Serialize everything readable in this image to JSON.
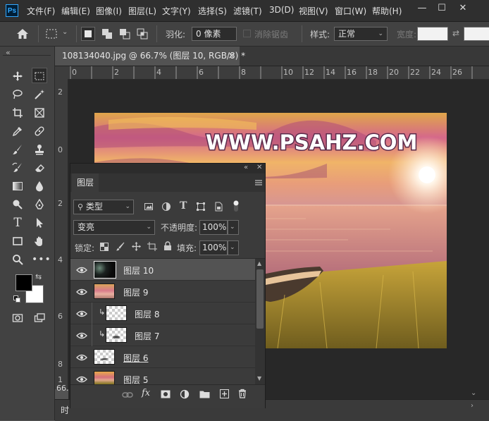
{
  "app": {
    "logo": "Ps"
  },
  "menu": [
    "文件(F)",
    "编辑(E)",
    "图像(I)",
    "图层(L)",
    "文字(Y)",
    "选择(S)",
    "滤镜(T)",
    "3D(D)",
    "视图(V)",
    "窗口(W)",
    "帮助(H)"
  ],
  "window_controls": {
    "minimize": "—",
    "maximize": "☐",
    "close": "✕"
  },
  "options_bar": {
    "feather_label": "羽化:",
    "feather_value": "0 像素",
    "antialias_label": "消除锯齿",
    "style_label": "样式:",
    "style_value": "正常",
    "width_label": "宽度:"
  },
  "document": {
    "tab_title": "108134040.jpg @ 66.7% (图层 10, RGB/8) *",
    "tab_close": "×",
    "zoom_status": "66.",
    "status_text": "时",
    "ruler_top": [
      "0",
      "2",
      "4",
      "6",
      "8",
      "10",
      "12",
      "14",
      "16",
      "18",
      "20",
      "22",
      "24",
      "26"
    ],
    "ruler_left": [
      "2",
      "0",
      "2",
      "4",
      "6",
      "8",
      "1"
    ],
    "image_watermark": "WWW.PSAHZ.COM"
  },
  "toolbar_collapse": "«",
  "layers_panel": {
    "collapse": "«",
    "close": "✕",
    "tab_label": "图层",
    "filter_label": "类型",
    "blend_mode": "变亮",
    "opacity_label": "不透明度:",
    "opacity_value": "100%",
    "lock_label": "锁定:",
    "fill_label": "填充:",
    "fill_value": "100%",
    "layers": [
      {
        "name": "图层 10",
        "selected": true,
        "clipped": false,
        "thumb": "dark-flare"
      },
      {
        "name": "图层 9",
        "selected": false,
        "clipped": false,
        "thumb": "sky"
      },
      {
        "name": "图层 8",
        "selected": false,
        "clipped": true,
        "thumb": "transparent"
      },
      {
        "name": "图层 7",
        "selected": false,
        "clipped": true,
        "thumb": "transparent"
      },
      {
        "name": "图层 6",
        "selected": false,
        "clipped": false,
        "thumb": "transparent"
      },
      {
        "name": "图层 5",
        "selected": false,
        "clipped": false,
        "thumb": "sunset"
      }
    ],
    "footer_icons": [
      "link-icon",
      "fx-icon",
      "mask-icon",
      "adjustment-icon",
      "folder-icon",
      "new-layer-icon",
      "trash-icon"
    ]
  },
  "colors": {
    "foreground": "#000000",
    "background": "#ffffff",
    "accent": "#31a8ff"
  }
}
